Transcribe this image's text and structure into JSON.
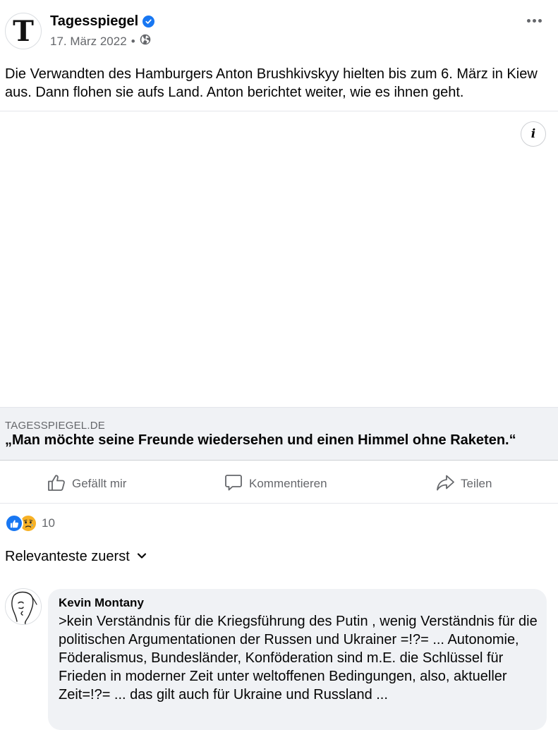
{
  "post": {
    "page_name": "Tagesspiegel",
    "date": "17. März 2022",
    "separator": "•",
    "audience_icon": "globe-icon",
    "text": "Die Verwandten des Hamburgers Anton Brushkivskyy hielten bis zum 6. März in Kiew aus. Dann flohen sie aufs Land. Anton berichtet weiter, wie es ihnen geht.",
    "avatar_letter": "T"
  },
  "media": {
    "info_icon": "i"
  },
  "link_preview": {
    "domain": "TAGESSPIEGEL.DE",
    "title": "„Man möchte seine Freunde wiedersehen und einen Himmel ohne Raketen.“"
  },
  "actions": {
    "like": "Gefällt mir",
    "comment": "Kommentieren",
    "share": "Teilen"
  },
  "reactions": {
    "count": "10",
    "types": [
      "like-icon",
      "sad-icon"
    ]
  },
  "sort": {
    "label": "Relevanteste zuerst"
  },
  "comment": {
    "author": "Kevin Montany",
    "text": ">kein Verständnis für die Kriegsführung des Putin , wenig Verständnis für die politischen Argumentationen der Russen und Ukrainer =!?= ... Autonomie, Föderalismus, Bundesländer, Konföderation sind m.E. die Schlüssel für Frieden in moderner Zeit unter weltoffenen Bedingungen, also, aktueller Zeit=!?= ... das gilt auch für Ukraine und Russland ..."
  },
  "colors": {
    "brand_blue": "#1877f2",
    "secondary_text": "#65676b",
    "surface_gray": "#f0f2f5"
  }
}
